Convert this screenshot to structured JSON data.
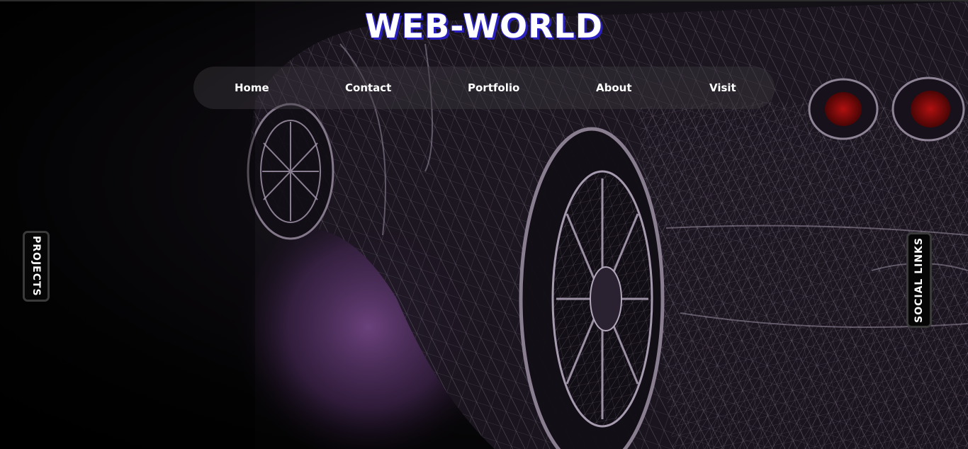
{
  "header": {
    "title": "WEB-WORLD"
  },
  "nav": {
    "items": [
      {
        "label": "Home"
      },
      {
        "label": "Contact"
      },
      {
        "label": "Portfolio"
      },
      {
        "label": "About"
      },
      {
        "label": "Visit"
      }
    ]
  },
  "side_tabs": {
    "left_label": "PROJECTS",
    "right_label": "SOCIAL LINKS"
  },
  "background": {
    "subject": "wireframe-car",
    "accent": "#6a3a7a",
    "taillight": "#8a0a0a",
    "wire": "#8f8496"
  }
}
